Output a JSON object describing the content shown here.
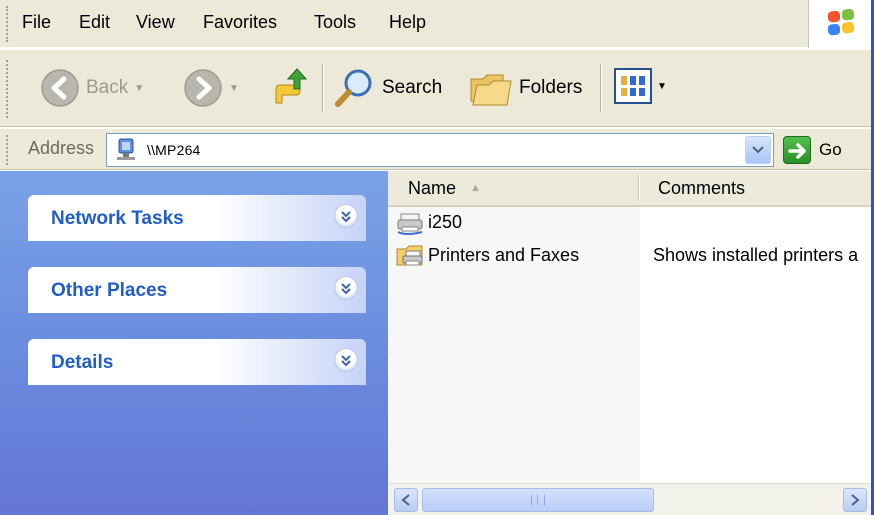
{
  "menubar": {
    "items": [
      "File",
      "Edit",
      "View",
      "Favorites",
      "Tools",
      "Help"
    ],
    "logo_icon": "windows-flag-icon"
  },
  "toolbar": {
    "back_label": "Back",
    "search_label": "Search",
    "folders_label": "Folders",
    "icons": {
      "back": "back-arrow-icon",
      "forward": "forward-arrow-icon",
      "up": "up-folder-icon",
      "search": "magnifier-icon",
      "folders": "folders-icon",
      "views": "views-icon"
    }
  },
  "address": {
    "label": "Address",
    "value": "\\\\MP264",
    "go_label": "Go"
  },
  "taskpane": {
    "groups": [
      {
        "title": "Network Tasks"
      },
      {
        "title": "Other Places"
      },
      {
        "title": "Details"
      }
    ],
    "colors": {
      "background": "#6c8fdf",
      "title": "#215dc6"
    }
  },
  "filelist": {
    "columns": [
      "Name",
      "Comments"
    ],
    "sorted_by": "Name",
    "rows": [
      {
        "name": "i250",
        "comment": "",
        "icon": "network-printer-icon"
      },
      {
        "name": "Printers and Faxes",
        "comment": "Shows installed printers a",
        "icon": "printers-folder-icon"
      }
    ]
  }
}
